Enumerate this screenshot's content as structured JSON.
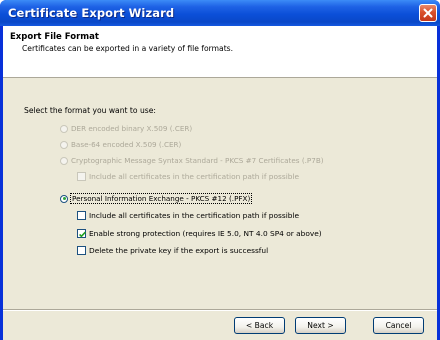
{
  "window": {
    "title": "Certificate Export Wizard"
  },
  "header": {
    "title": "Export File Format",
    "subtitle": "Certificates can be exported in a variety of file formats."
  },
  "content": {
    "prompt": "Select the format you want to use:",
    "formats": [
      {
        "label": "DER encoded binary X.509 (.CER)",
        "enabled": false,
        "selected": false
      },
      {
        "label": "Base-64 encoded X.509 (.CER)",
        "enabled": false,
        "selected": false
      },
      {
        "label": "Cryptographic Message Syntax Standard - PKCS #7 Certificates (.P7B)",
        "enabled": false,
        "selected": false
      },
      {
        "label": "Personal Information Exchange - PKCS #12 (.PFX)",
        "enabled": true,
        "selected": true
      }
    ],
    "options": [
      {
        "label": "Include all certificates in the certification path if possible",
        "enabled": false,
        "checked": false
      },
      {
        "label": "Include all certificates in the certification path if possible",
        "enabled": true,
        "checked": false
      },
      {
        "label": "Enable strong protection (requires IE 5.0, NT 4.0 SP4 or above)",
        "enabled": true,
        "checked": true
      },
      {
        "label": "Delete the private key if the export is successful",
        "enabled": true,
        "checked": false
      }
    ]
  },
  "buttons": {
    "back": "< Back",
    "next": "Next >",
    "cancel": "Cancel"
  },
  "colors": {
    "title_bar": "#0b4fd8",
    "dialog_bg": "#ece9d8",
    "close_button": "#d9502a",
    "checked_radio": "#2fa33a"
  },
  "icons": {
    "close": "close-icon"
  }
}
